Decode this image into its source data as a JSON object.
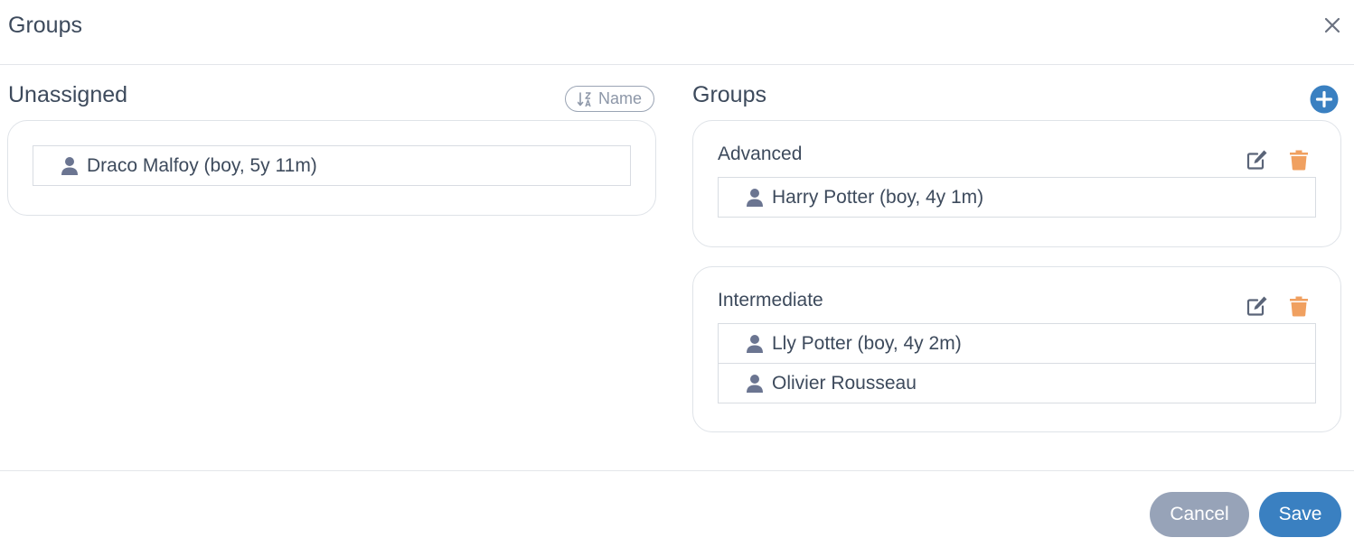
{
  "modal": {
    "title": "Groups"
  },
  "unassigned": {
    "title": "Unassigned",
    "sort_label": "Name",
    "members": [
      {
        "name": "Draco Malfoy (boy, 5y 11m)"
      }
    ]
  },
  "groups": {
    "title": "Groups",
    "items": [
      {
        "name": "Advanced",
        "members": [
          {
            "name": "Harry Potter (boy, 4y 1m)"
          }
        ]
      },
      {
        "name": "Intermediate",
        "members": [
          {
            "name": "Lly Potter (boy, 4y 2m)"
          },
          {
            "name": "Olivier Rousseau"
          }
        ]
      }
    ]
  },
  "footer": {
    "cancel_label": "Cancel",
    "save_label": "Save"
  },
  "colors": {
    "primary": "#3a80c1",
    "cancel": "#97a3b8",
    "edit_icon": "#5a6478",
    "delete_icon": "#f0a060",
    "person_icon": "#6b7591"
  },
  "icons": [
    "close-icon",
    "sort-alpha-icon",
    "plus-circle-icon",
    "person-icon",
    "edit-icon",
    "trash-icon"
  ]
}
